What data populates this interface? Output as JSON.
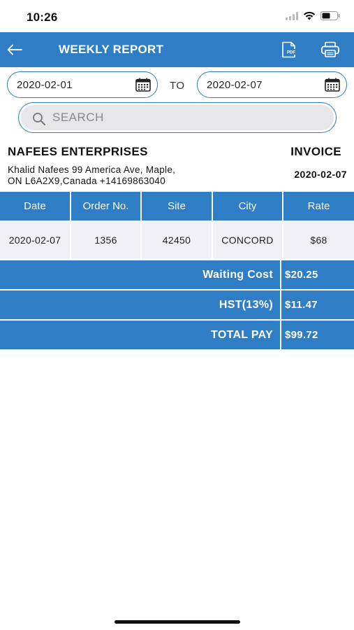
{
  "status_bar": {
    "time": "10:26"
  },
  "header": {
    "title": "WEEKLY REPORT",
    "back_icon": "arrow-left-icon",
    "pdf_icon": "pdf-icon",
    "print_icon": "printer-icon"
  },
  "date_range": {
    "from": "2020-02-01",
    "to_label": "TO",
    "to": "2020-02-07"
  },
  "search": {
    "placeholder": "SEARCH"
  },
  "company": {
    "name": "NAFEES ENTERPRISES",
    "address_line1": "Khalid Nafees 99 America Ave, Maple,",
    "address_line2": "ON L6A2X9,Canada +14169863040"
  },
  "invoice": {
    "label": "INVOICE",
    "date": "2020-02-07"
  },
  "table": {
    "columns": [
      "Date",
      "Order No.",
      "Site",
      "City",
      "Rate"
    ],
    "rows": [
      {
        "date": "2020-02-07",
        "order_no": "1356",
        "site": "42450",
        "city": "CONCORD",
        "rate": "$68"
      }
    ]
  },
  "summary": [
    {
      "label": "Waiting Cost",
      "value": "$20.25"
    },
    {
      "label": "HST(13%)",
      "value": "$11.47"
    },
    {
      "label": "TOTAL PAY",
      "value": "$99.72"
    }
  ],
  "colors": {
    "primary": "#2f7dc4",
    "row_bg": "#f1f1f5",
    "search_bg": "#e6e6e9"
  }
}
